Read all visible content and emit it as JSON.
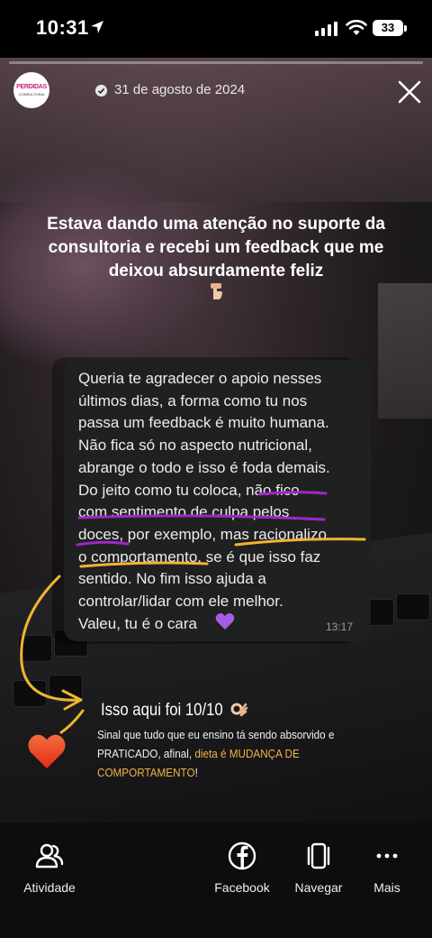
{
  "status_bar": {
    "time": "10:31",
    "battery": "33"
  },
  "story": {
    "date": "31 de agosto de 2024",
    "headline": [
      "Estava dando uma atenção no suporte da",
      "consultoria e recebi um feedback que me",
      "deixou absurdamente feliz"
    ],
    "message": {
      "lines": [
        "Queria te agradecer o apoio nesses",
        "últimos dias, a forma como tu nos",
        "passa um feedback é muito humana.",
        "Não fica só no aspecto nutricional,",
        "abrange o todo e isso é foda demais.",
        "Do jeito como tu coloca, não fico",
        "com sentimento de culpa pelos",
        "doces, por exemplo, mas racionalizo",
        "o comportamento, se é que isso faz",
        "sentido. No fim isso ajuda a",
        "controlar/lidar com ele melhor.",
        "Valeu, tu é o cara"
      ],
      "time": "13:17"
    },
    "caption_title": "Isso aqui foi 10/10",
    "caption_body_line1": "Sinal que tudo que eu ensino tá sendo absorvido e",
    "caption_body_line2_plain": "PRATICADO, afinal, ",
    "caption_body_line2_highlight": "dieta é MUDANÇA DE COMPORTAMENTO",
    "caption_body_line2_end": "!"
  },
  "nav": {
    "items": [
      {
        "label": "Atividade",
        "icon": "people-activity-icon"
      },
      {
        "label": "Facebook",
        "icon": "facebook-icon"
      },
      {
        "label": "Navegar",
        "icon": "pages-icon"
      },
      {
        "label": "Mais",
        "icon": "more-dots-icon"
      }
    ]
  },
  "colors": {
    "purple_underline": "#a126c9",
    "yellow_underline": "#f0b531",
    "caption_highlight": "#f0b44a"
  }
}
